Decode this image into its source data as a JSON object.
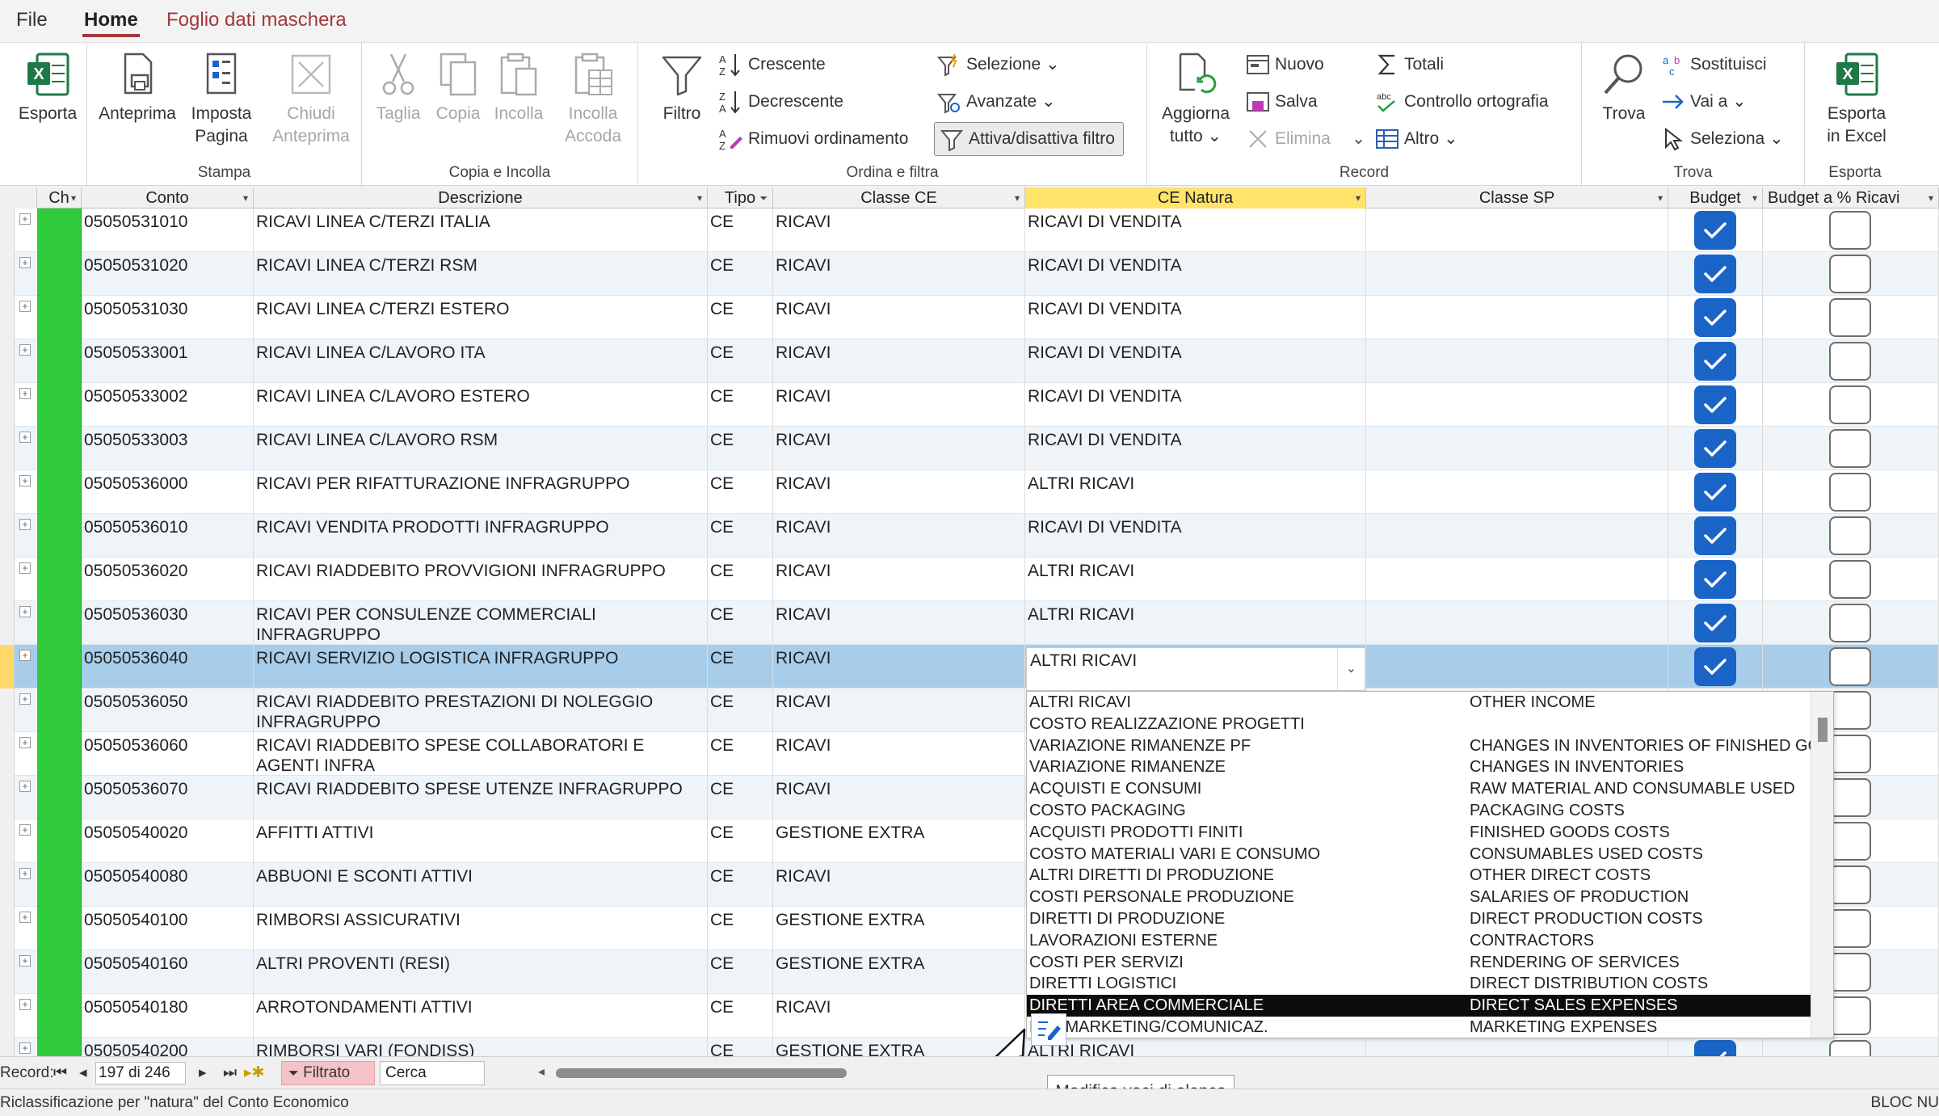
{
  "menu": {
    "file": "File",
    "home": "Home",
    "sheet": "Foglio dati maschera"
  },
  "ribbon": {
    "export_excel": "Esporta",
    "preview": "Anteprima",
    "page_setup_1": "Imposta",
    "page_setup_2": "Pagina",
    "close_preview_1": "Chiudi",
    "close_preview_2": "Anteprima",
    "print_group": "Stampa",
    "cut": "Taglia",
    "copy": "Copia",
    "paste": "Incolla",
    "paste_append_1": "Incolla",
    "paste_append_2": "Accoda",
    "clip_group": "Copia e Incolla",
    "filter": "Filtro",
    "asc": "Crescente",
    "desc": "Decrescente",
    "remove_sort": "Rimuovi ordinamento",
    "selection": "Selezione",
    "advanced": "Avanzate",
    "toggle_filter": "Attiva/disattiva filtro",
    "sort_group": "Ordina e filtra",
    "refresh_1": "Aggiorna",
    "refresh_2": "tutto",
    "new": "Nuovo",
    "save": "Salva",
    "delete": "Elimina",
    "totals": "Totali",
    "spelling": "Controllo ortografia",
    "more": "Altro",
    "record_group": "Record",
    "find": "Trova",
    "replace": "Sostituisci",
    "goto": "Vai a",
    "select": "Seleziona",
    "find_group": "Trova",
    "export_excel2_1": "Esporta",
    "export_excel2_2": "in Excel",
    "export_group": "Esporta"
  },
  "columns": [
    "Ch",
    "Conto",
    "Descrizione",
    "Tipo",
    "Classe CE",
    "CE Natura",
    "Classe SP",
    "Budget",
    "Budget a % Ricavi"
  ],
  "rows": [
    {
      "conto": "05050531010",
      "descr": "RICAVI LINEA C/TERZI ITALIA",
      "tipo": "CE",
      "classe": "RICAVI",
      "natura": "RICAVI DI VENDITA",
      "budget": true
    },
    {
      "conto": "05050531020",
      "descr": "RICAVI LINEA C/TERZI RSM",
      "tipo": "CE",
      "classe": "RICAVI",
      "natura": "RICAVI DI VENDITA",
      "budget": true
    },
    {
      "conto": "05050531030",
      "descr": "RICAVI LINEA C/TERZI ESTERO",
      "tipo": "CE",
      "classe": "RICAVI",
      "natura": "RICAVI DI VENDITA",
      "budget": true
    },
    {
      "conto": "05050533001",
      "descr": "RICAVI LINEA C/LAVORO ITA",
      "tipo": "CE",
      "classe": "RICAVI",
      "natura": "RICAVI DI VENDITA",
      "budget": true
    },
    {
      "conto": "05050533002",
      "descr": "RICAVI LINEA C/LAVORO ESTERO",
      "tipo": "CE",
      "classe": "RICAVI",
      "natura": "RICAVI DI VENDITA",
      "budget": true
    },
    {
      "conto": "05050533003",
      "descr": "RICAVI LINEA C/LAVORO RSM",
      "tipo": "CE",
      "classe": "RICAVI",
      "natura": "RICAVI DI VENDITA",
      "budget": true
    },
    {
      "conto": "05050536000",
      "descr": "RICAVI PER RIFATTURAZIONE INFRAGRUPPO",
      "tipo": "CE",
      "classe": "RICAVI",
      "natura": "ALTRI RICAVI",
      "budget": true
    },
    {
      "conto": "05050536010",
      "descr": "RICAVI VENDITA PRODOTTI INFRAGRUPPO",
      "tipo": "CE",
      "classe": "RICAVI",
      "natura": "RICAVI DI VENDITA",
      "budget": true
    },
    {
      "conto": "05050536020",
      "descr": "RICAVI RIADDEBITO PROVVIGIONI INFRAGRUPPO",
      "tipo": "CE",
      "classe": "RICAVI",
      "natura": "ALTRI RICAVI",
      "budget": true
    },
    {
      "conto": "05050536030",
      "descr": "RICAVI PER CONSULENZE COMMERCIALI INFRAGRUPPO",
      "tipo": "CE",
      "classe": "RICAVI",
      "natura": "ALTRI RICAVI",
      "budget": true
    },
    {
      "conto": "05050536040",
      "descr": "RICAVI SERVIZIO LOGISTICA INFRAGRUPPO",
      "tipo": "CE",
      "classe": "RICAVI",
      "natura": "ALTRI RICAVI",
      "budget": true
    },
    {
      "conto": "05050536050",
      "descr": "RICAVI RIADDEBITO PRESTAZIONI DI NOLEGGIO INFRAGRUPPO",
      "tipo": "CE",
      "classe": "RICAVI",
      "natura": "",
      "budget": false
    },
    {
      "conto": "05050536060",
      "descr": "RICAVI RIADDEBITO SPESE COLLABORATORI E AGENTI INFRA",
      "tipo": "CE",
      "classe": "RICAVI",
      "natura": "",
      "budget": false
    },
    {
      "conto": "05050536070",
      "descr": "RICAVI RIADDEBITO SPESE UTENZE INFRAGRUPPO",
      "tipo": "CE",
      "classe": "RICAVI",
      "natura": "",
      "budget": false
    },
    {
      "conto": "05050540020",
      "descr": "AFFITTI ATTIVI",
      "tipo": "CE",
      "classe": "GESTIONE EXTRA",
      "natura": "",
      "budget": false
    },
    {
      "conto": "05050540080",
      "descr": "ABBUONI E SCONTI ATTIVI",
      "tipo": "CE",
      "classe": "RICAVI",
      "natura": "",
      "budget": false
    },
    {
      "conto": "05050540100",
      "descr": "RIMBORSI ASSICURATIVI",
      "tipo": "CE",
      "classe": "GESTIONE EXTRA",
      "natura": "",
      "budget": false
    },
    {
      "conto": "05050540160",
      "descr": "ALTRI PROVENTI (RESI)",
      "tipo": "CE",
      "classe": "GESTIONE EXTRA",
      "natura": "",
      "budget": false
    },
    {
      "conto": "05050540180",
      "descr": "ARROTONDAMENTI ATTIVI",
      "tipo": "CE",
      "classe": "RICAVI",
      "natura": "",
      "budget": false
    },
    {
      "conto": "05050540200",
      "descr": "RIMBORSI VARI (FONDISS)",
      "tipo": "CE",
      "classe": "GESTIONE EXTRA",
      "natura": "ALTRI RICAVI",
      "budget": true
    }
  ],
  "current_value": "ALTRI RICAVI",
  "dropdown": [
    {
      "a": "ALTRI RICAVI",
      "b": "OTHER INCOME"
    },
    {
      "a": "COSTO REALIZZAZIONE PROGETTI",
      "b": ""
    },
    {
      "a": "VARIAZIONE RIMANENZE PF",
      "b": "CHANGES IN INVENTORIES OF FINISHED GOC"
    },
    {
      "a": "VARIAZIONE RIMANENZE",
      "b": "CHANGES IN INVENTORIES"
    },
    {
      "a": "ACQUISTI E CONSUMI",
      "b": "RAW MATERIAL AND CONSUMABLE USED"
    },
    {
      "a": "COSTO PACKAGING",
      "b": "PACKAGING COSTS"
    },
    {
      "a": "ACQUISTI PRODOTTI FINITI",
      "b": "FINISHED GOODS COSTS"
    },
    {
      "a": "COSTO MATERIALI VARI E CONSUMO",
      "b": "CONSUMABLES USED COSTS"
    },
    {
      "a": "ALTRI DIRETTI DI PRODUZIONE",
      "b": "OTHER DIRECT COSTS"
    },
    {
      "a": "COSTI PERSONALE PRODUZIONE",
      "b": "SALARIES OF PRODUCTION"
    },
    {
      "a": "DIRETTI DI PRODUZIONE",
      "b": "DIRECT PRODUCTION COSTS"
    },
    {
      "a": "LAVORAZIONI ESTERNE",
      "b": "CONTRACTORS"
    },
    {
      "a": "COSTI PER SERVIZI",
      "b": "RENDERING OF SERVICES"
    },
    {
      "a": "DIRETTI LOGISTICI",
      "b": "DIRECT DISTRIBUTION COSTS"
    },
    {
      "a": "DIRETTI AREA COMMERCIALE",
      "b": "DIRECT SALES EXPENSES",
      "highlight": true
    },
    {
      "a": "E DI MARKETING/COMUNICAZ.",
      "b": "MARKETING EXPENSES"
    }
  ],
  "nav": {
    "record_label": "Record:",
    "record_pos": "197 di 246",
    "filtered": "Filtrato",
    "search": "Cerca"
  },
  "tooltip": "Modifica voci di elenco",
  "status": {
    "left": "Riclassificazione per \"natura\" del Conto Economico",
    "right": "BLOC NU"
  },
  "colors": {
    "accent": "#a4373a",
    "check": "#1a64c8",
    "green": "#2fcb3a",
    "current_row": "#a8cdea"
  }
}
